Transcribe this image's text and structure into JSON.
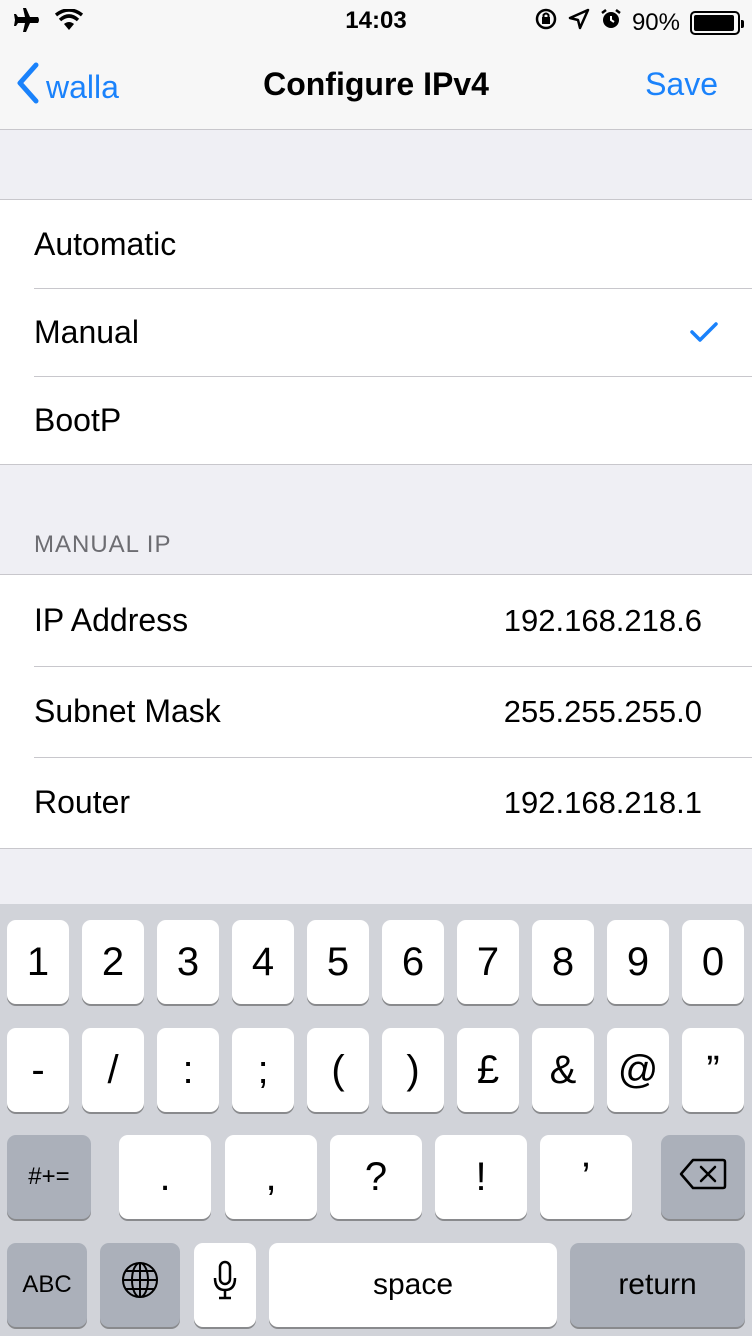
{
  "status_bar": {
    "time": "14:03",
    "battery": "90%",
    "icons": [
      "airplane-icon",
      "wifi-icon",
      "rotation-lock-icon",
      "location-icon",
      "alarm-icon",
      "battery-icon"
    ]
  },
  "nav": {
    "back_label": "walla",
    "title": "Configure IPv4",
    "save_label": "Save"
  },
  "configure_options": [
    {
      "label": "Automatic",
      "selected": false
    },
    {
      "label": "Manual",
      "selected": true
    },
    {
      "label": "BootP",
      "selected": false
    }
  ],
  "manual_ip": {
    "header": "MANUAL IP",
    "ip_address": {
      "label": "IP Address",
      "value": "192.168.218.6"
    },
    "subnet_mask": {
      "label": "Subnet Mask",
      "value": "255.255.255.0"
    },
    "router": {
      "label": "Router",
      "value": "192.168.218.1"
    }
  },
  "keyboard": {
    "row1": [
      "1",
      "2",
      "3",
      "4",
      "5",
      "6",
      "7",
      "8",
      "9",
      "0"
    ],
    "row2": [
      "-",
      "/",
      ":",
      ";",
      "(",
      ")",
      "£",
      "&",
      "@",
      "”"
    ],
    "row3": [
      "#+=",
      ".",
      ",",
      "?",
      "!",
      "’"
    ],
    "abc_label": "ABC",
    "space_label": "space",
    "return_label": "return"
  },
  "colors": {
    "accent": "#1a82fb",
    "background": "#efeff4",
    "keyboard_bg": "#d1d3d9"
  }
}
